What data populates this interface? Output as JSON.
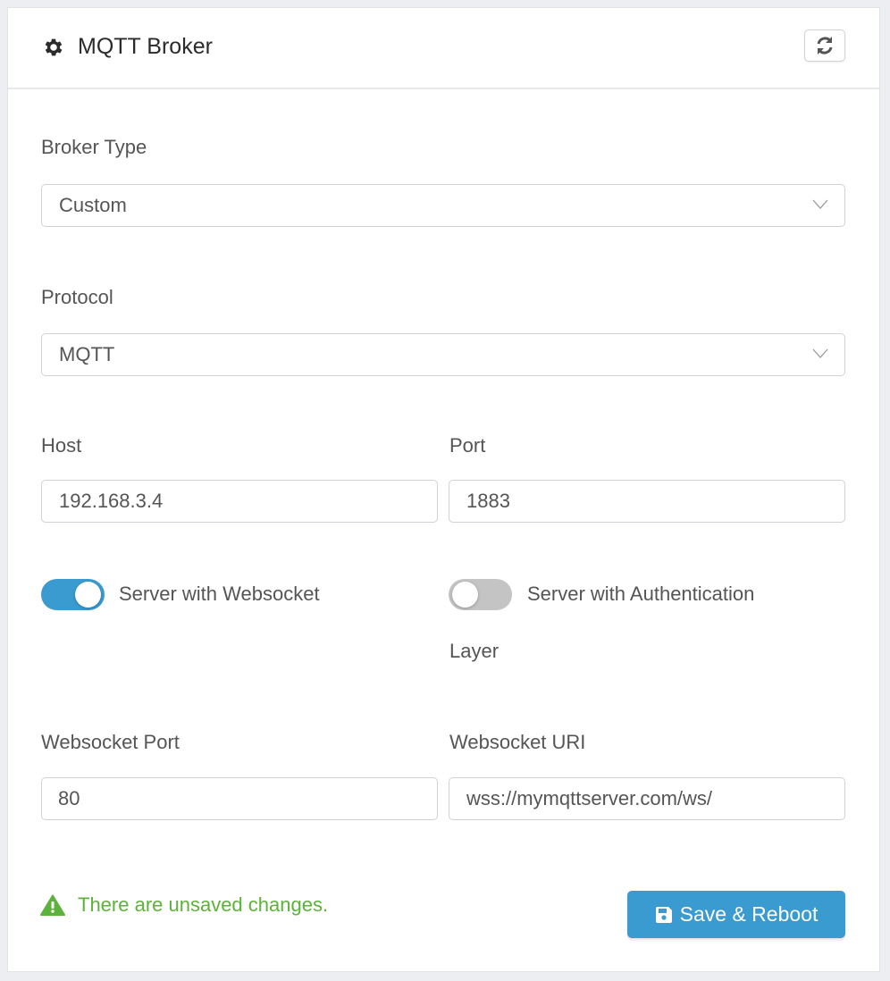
{
  "header": {
    "title": "MQTT Broker",
    "title_icon": "gear-icon",
    "refresh_icon": "refresh-icon"
  },
  "form": {
    "broker_type": {
      "label": "Broker Type",
      "value": "Custom"
    },
    "protocol": {
      "label": "Protocol",
      "value": "MQTT"
    },
    "host": {
      "label": "Host",
      "value": "192.168.3.4"
    },
    "port": {
      "label": "Port",
      "value": "1883"
    },
    "websocket_toggle": {
      "label": "Server with Websocket",
      "checked": true
    },
    "auth_toggle": {
      "label_line1": "Server with Authentication",
      "label_line2": "Layer",
      "checked": false
    },
    "websocket_port": {
      "label": "Websocket Port",
      "value": "80"
    },
    "websocket_uri": {
      "label": "Websocket URI",
      "value": "wss://mymqttserver.com/ws/"
    }
  },
  "footer": {
    "warning_text": "There are unsaved changes.",
    "warning_icon": "warning-icon",
    "save_label": "Save & Reboot",
    "save_icon": "floppy-disk-icon"
  },
  "colors": {
    "accent": "#3a9bd0",
    "warning": "#5cb23a",
    "toggle_off": "#c4c4c4"
  }
}
